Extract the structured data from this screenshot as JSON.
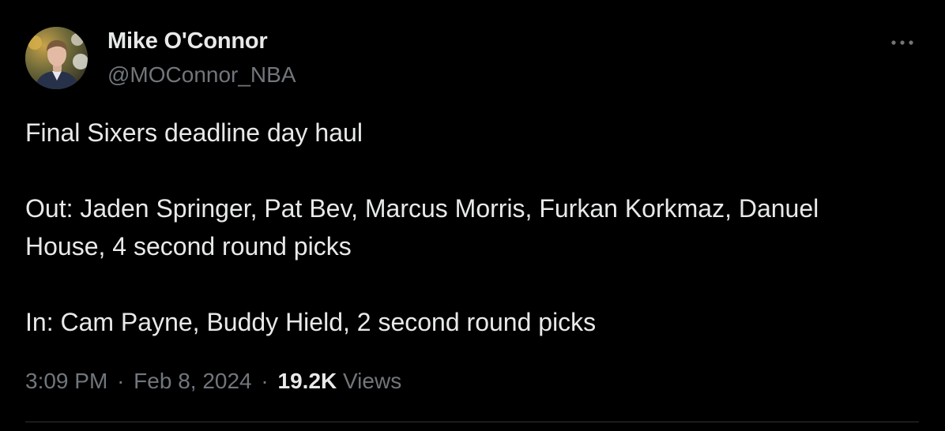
{
  "author": {
    "name": "Mike O'Connor",
    "handle": "@MOConnor_NBA"
  },
  "tweet": {
    "paragraphs": [
      "Final Sixers deadline day haul",
      "Out: Jaden Springer, Pat Bev, Marcus Morris, Furkan Korkmaz, Danuel House, 4 second round picks",
      "In: Cam Payne, Buddy Hield, 2 second round picks"
    ]
  },
  "meta": {
    "time": "3:09 PM",
    "separator": "·",
    "date": "Feb 8, 2024",
    "views_count": "19.2K",
    "views_label": "Views"
  },
  "icons": {
    "more": "more-horizontal-icon",
    "avatar": "profile-photo"
  },
  "colors": {
    "background": "#000000",
    "primary_text": "#e7e9ea",
    "secondary_text": "#71767b",
    "divider": "#2f3336"
  }
}
